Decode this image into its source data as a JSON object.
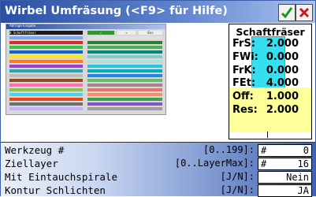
{
  "window": {
    "title": "Wirbel Umfräsung (<F9> für Hilfe)",
    "confirm_icon": "checkmark-icon",
    "cancel_icon": "close-icon"
  },
  "thumbnail": {
    "title": "Abfrage Eingabe",
    "header": "0 Schaftfräser",
    "button_ok": "✓",
    "button_cancel": "✕",
    "button_esc": "Esc",
    "row_colors_left": [
      "#7ea8f0",
      "#d32f2f",
      "#3fbf3f",
      "#1565c0",
      "#f2e82a",
      "#ff7a1a",
      "#a03ad0",
      "#26a7a7",
      "#bcbcbc",
      "#8e4e1a",
      "#ff6fb5",
      "#8bc34a",
      "#4fd1e6",
      "#e64a19",
      "#6f6f6f",
      "#c4b2ff"
    ],
    "row_colors_right": [
      "#e0e0e0",
      "#2e7d32",
      "#4caf50",
      "#00897b",
      "#80cbc4",
      "#b2dfdb",
      "#26c6da",
      "#00acc1",
      "#1e88e5",
      "#66bb6a",
      "#a1887f",
      "#e57373",
      "#ff8a65",
      "#43a047",
      "#7e57c2",
      "#9e9e9e"
    ]
  },
  "tool_panel": {
    "heading": "Schaftfräser",
    "properties": [
      {
        "label": "FrS:",
        "value": "2.000"
      },
      {
        "label": "FWi:",
        "value": "0.000"
      },
      {
        "label": "FrK:",
        "value": "0.000"
      },
      {
        "label": "FEt:",
        "value": "4.000"
      },
      {
        "label": "Off:",
        "value": "1.000"
      },
      {
        "label": "Res:",
        "value": "2.000"
      }
    ]
  },
  "form": {
    "rows": [
      {
        "label": "Werkzeug #",
        "range": "[0..199]:",
        "hash": "#",
        "value": "0"
      },
      {
        "label": "Ziellayer",
        "range": "[0..LayerMax]:",
        "hash": "#",
        "value": "16"
      },
      {
        "label": "Mit Eintauchspirale",
        "range": "[J/N]:",
        "hash": "",
        "value": "Nein"
      },
      {
        "label": "Kontur Schlichten",
        "range": "[J/N]:",
        "hash": "",
        "value": "JA"
      }
    ]
  }
}
